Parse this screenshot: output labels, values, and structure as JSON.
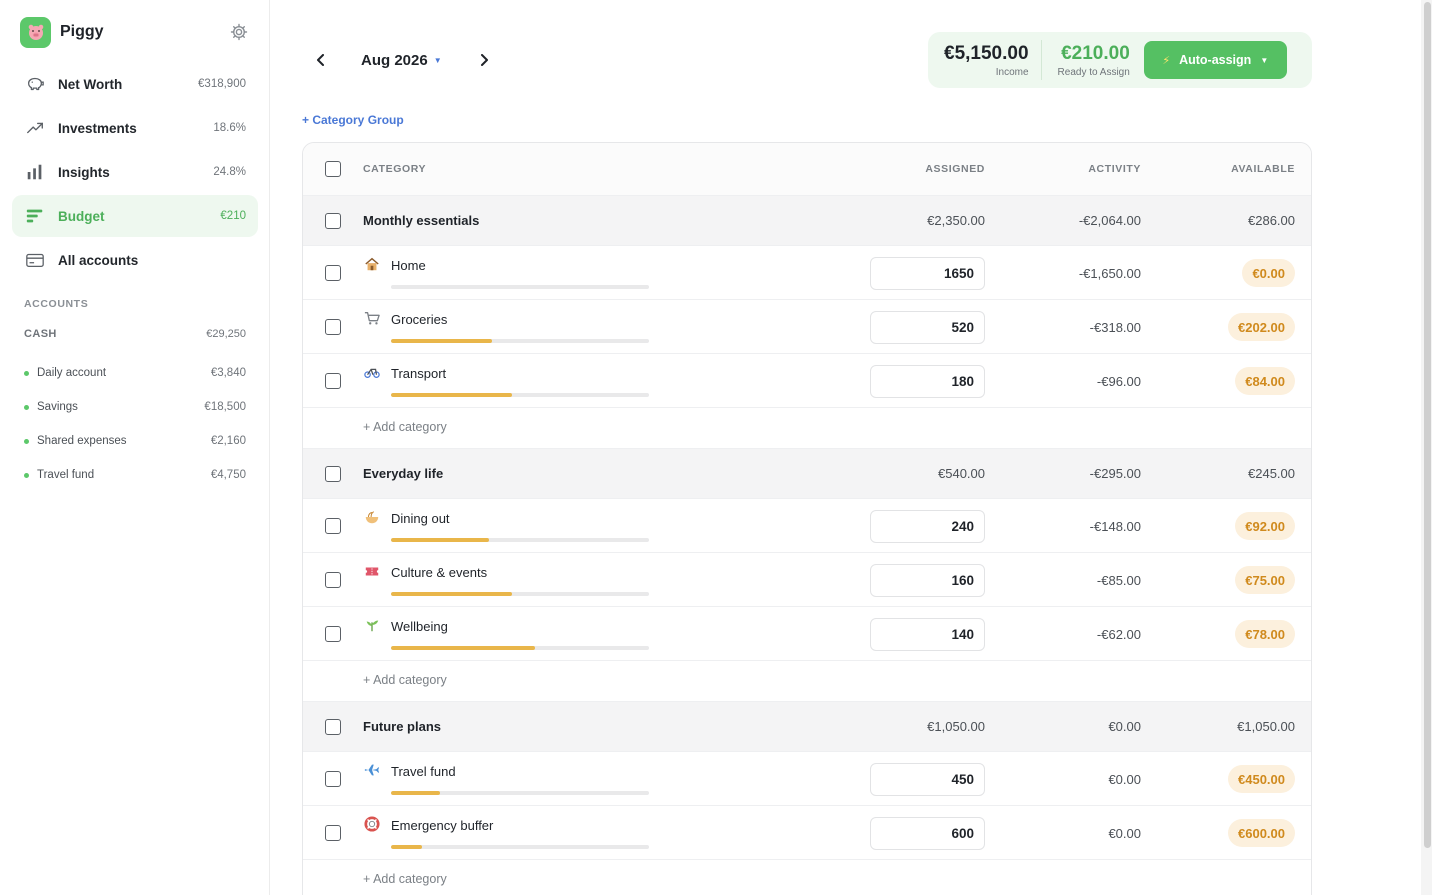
{
  "app": {
    "name": "Piggy"
  },
  "nav": [
    {
      "label": "Net Worth",
      "value": "€318,900",
      "icon": "piggy-bank-icon"
    },
    {
      "label": "Investments",
      "value": "18.6%",
      "icon": "trend-up-icon"
    },
    {
      "label": "Insights",
      "value": "24.8%",
      "icon": "bar-chart-icon"
    },
    {
      "label": "Budget",
      "value": "€210",
      "icon": "budget-icon",
      "active": true
    },
    {
      "label": "All accounts",
      "value": "",
      "icon": "card-icon"
    }
  ],
  "accounts_section": {
    "title": "ACCOUNTS",
    "cash_label": "CASH",
    "cash_total": "€29,250",
    "items": [
      {
        "name": "Daily account",
        "value": "€3,840"
      },
      {
        "name": "Savings",
        "value": "€18,500"
      },
      {
        "name": "Shared expenses",
        "value": "€2,160"
      },
      {
        "name": "Travel fund",
        "value": "€4,750"
      }
    ]
  },
  "header": {
    "month": "Aug 2026",
    "income": "€5,150.00",
    "income_label": "Income",
    "ready": "€210.00",
    "ready_label": "Ready to Assign",
    "auto_assign": "Auto-assign",
    "add_group": "+ Category Group"
  },
  "table": {
    "columns": {
      "category": "CATEGORY",
      "assigned": "ASSIGNED",
      "activity": "ACTIVITY",
      "available": "AVAILABLE"
    },
    "add_category": "+ Add category",
    "groups": [
      {
        "name": "Monthly essentials",
        "assigned": "€2,350.00",
        "activity": "-€2,064.00",
        "available": "€286.00",
        "categories": [
          {
            "name": "Home",
            "icon": "house-icon",
            "assigned": "1650",
            "activity": "-€1,650.00",
            "available": "€0.00",
            "progress": 0
          },
          {
            "name": "Groceries",
            "icon": "cart-icon",
            "assigned": "520",
            "activity": "-€318.00",
            "available": "€202.00",
            "progress": 0.39
          },
          {
            "name": "Transport",
            "icon": "bicycle-icon",
            "assigned": "180",
            "activity": "-€96.00",
            "available": "€84.00",
            "progress": 0.47
          }
        ]
      },
      {
        "name": "Everyday life",
        "assigned": "€540.00",
        "activity": "-€295.00",
        "available": "€245.00",
        "categories": [
          {
            "name": "Dining out",
            "icon": "noodle-bowl-icon",
            "assigned": "240",
            "activity": "-€148.00",
            "available": "€92.00",
            "progress": 0.38
          },
          {
            "name": "Culture & events",
            "icon": "ticket-icon",
            "assigned": "160",
            "activity": "-€85.00",
            "available": "€75.00",
            "progress": 0.47
          },
          {
            "name": "Wellbeing",
            "icon": "herb-icon",
            "assigned": "140",
            "activity": "-€62.00",
            "available": "€78.00",
            "progress": 0.56
          }
        ]
      },
      {
        "name": "Future plans",
        "assigned": "€1,050.00",
        "activity": "€0.00",
        "available": "€1,050.00",
        "categories": [
          {
            "name": "Travel fund",
            "icon": "airplane-icon",
            "assigned": "450",
            "activity": "€0.00",
            "available": "€450.00",
            "progress": 0.19
          },
          {
            "name": "Emergency buffer",
            "icon": "lifebuoy-icon",
            "assigned": "600",
            "activity": "€0.00",
            "available": "€600.00",
            "progress": 0.12
          }
        ]
      }
    ]
  }
}
